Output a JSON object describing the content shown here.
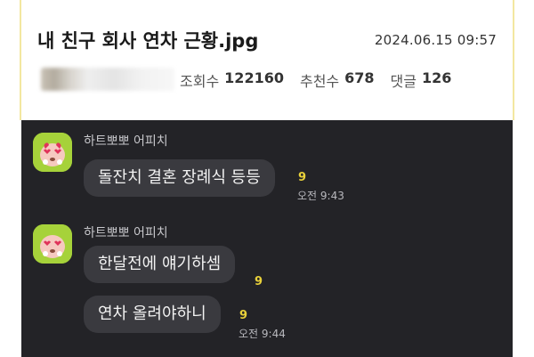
{
  "post": {
    "title": "내 친구 회사 연차 근황.jpg",
    "date": "2024.06.15 09:57",
    "stats": [
      {
        "label": "조회수",
        "value": "122160"
      },
      {
        "label": "추천수",
        "value": "678"
      },
      {
        "label": "댓글",
        "value": "126"
      }
    ]
  },
  "chat": {
    "groups": [
      {
        "sender": "하트뽀뽀 어피치",
        "messages": [
          {
            "text": "돌잔치 결혼 장례식 등등",
            "unread": "9",
            "time": "오전 9:43"
          }
        ]
      },
      {
        "sender": "하트뽀뽀 어피치",
        "messages": [
          {
            "text": "한달전에 얘기하셈",
            "unread": "9",
            "time": ""
          },
          {
            "text": "연차 올려야하니",
            "unread": "9",
            "time": "오전 9:44"
          }
        ]
      }
    ]
  },
  "colors": {
    "chat_background": "#232327",
    "bubble": "#3a3a3f",
    "unread_count": "#e9d13a",
    "avatar_bg": "#a6d23a"
  }
}
